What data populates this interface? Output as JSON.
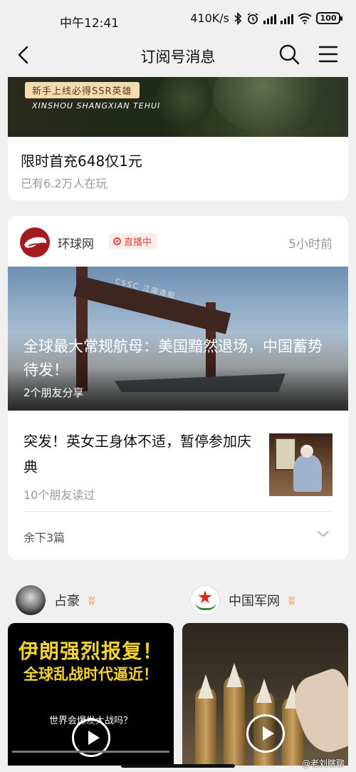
{
  "status_bar": {
    "time": "中午12:41",
    "net_speed": "410K/s",
    "battery": "100"
  },
  "nav": {
    "title": "订阅号消息",
    "back_icon": "back-arrow-icon",
    "search_icon": "search-icon",
    "menu_icon": "menu-icon"
  },
  "game_card": {
    "banner_tag": "新手上线必得SSR英雄",
    "banner_sub": "XINSHOU SHANGXIAN TEHUI",
    "headline": "限时首充648仅1元",
    "meta": "已有6.2万人在玩"
  },
  "news_card": {
    "source": "环球网",
    "live_label": "直播中",
    "time": "5小时前",
    "hero": {
      "crane_text": "CSSC 江南造船",
      "title": "全球最大常规航母：美国黯然退场，中国蓄势待发！",
      "sub": "2个朋友分享"
    },
    "item2": {
      "title": "突发！英女王身体不适，暂停参加庆典",
      "meta": "10个朋友读过"
    },
    "more": "余下3篇"
  },
  "authors": [
    {
      "name": "占豪",
      "badge": "ʬ"
    },
    {
      "name": "中国军网",
      "badge": "ʬ"
    }
  ],
  "videos": [
    {
      "line1": "伊朗强烈报复！",
      "line2": "全球乱战时代逼近！",
      "line3": "世界会爆发大战吗？"
    },
    {}
  ],
  "watermark": "@老刘瞎聊",
  "colors": {
    "live_red": "#e0473f",
    "verified_gold": "#e8a23a",
    "video_title_yellow": "#f2d230"
  }
}
